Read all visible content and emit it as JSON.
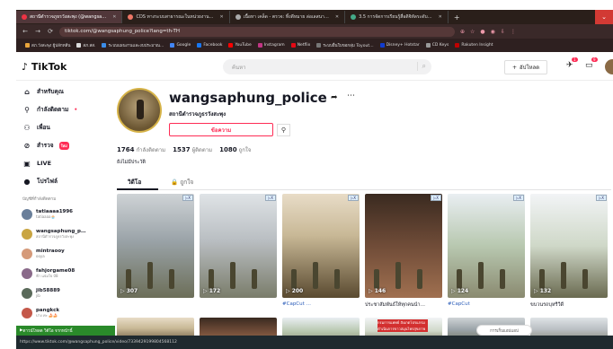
{
  "browser": {
    "tabs": [
      {
        "label": "สถานีตำรวจภูธรวังสะพุง (@wangsa…",
        "active": true
      },
      {
        "label": "CDS ทางระบบสาธารณะในหน่วยงาน…",
        "active": false
      },
      {
        "label": "เนื้อหา เคล็ด - ตรวจ: ทิ้งดีหมาย ล่อเลสนา…",
        "active": false
      },
      {
        "label": "3.5 การจัดการเรียนรู้สื่อดิจิทัลระดับ…",
        "active": false
      }
    ],
    "new_tab": "+",
    "url": "tiktok.com/@wangsaphung_police?lang=th-TH",
    "bookmarks": [
      {
        "label": "สภ.วังสะพุง ผู้ปลักทลีน",
        "color": "#e9a53b"
      },
      {
        "label": "สภ.สส.",
        "color": "#ddd"
      },
      {
        "label": "ระบบแผนงานและงบประมาณ…",
        "color": "#3b8de9"
      },
      {
        "label": "Google",
        "color": "#4285f4"
      },
      {
        "label": "Facebook",
        "color": "#1877f2"
      },
      {
        "label": "YouTube",
        "color": "#ff0000"
      },
      {
        "label": "Instagram",
        "color": "#c13584"
      },
      {
        "label": "Netflix",
        "color": "#e50914"
      },
      {
        "label": "ระบบยื่นใบขอกลุ่ม Toyout…",
        "color": "#777"
      },
      {
        "label": "Disney+ Hotstar",
        "color": "#113ccf"
      },
      {
        "label": "CD Keys",
        "color": "#999"
      },
      {
        "label": "Rakuten Insight",
        "color": "#bf0000"
      }
    ],
    "status_url": "https://www.tiktok.com/@wangsaphung_police/video/7339429199804568112",
    "download_label": "ดาวน์โหลด วิดีโอ จากหน้านี้"
  },
  "header": {
    "logo": "TikTok",
    "search_placeholder": "ค้นหา",
    "upload_label": "อัปโหลด",
    "inbox_badge": "1",
    "messages_badge": "9"
  },
  "sidebar": {
    "nav": [
      {
        "label": "สำหรับคุณ",
        "icon": "home-icon"
      },
      {
        "label": "กำลังติดตาม",
        "icon": "following-icon"
      },
      {
        "label": "เพื่อน",
        "icon": "friends-icon"
      },
      {
        "label": "สำรวจ",
        "icon": "explore-icon",
        "badge": "ใหม่"
      },
      {
        "label": "LIVE",
        "icon": "live-icon"
      },
      {
        "label": "โปรไฟล์",
        "icon": "profile-icon"
      }
    ],
    "following_title": "บัญชีที่กำลังติดตาม",
    "accounts": [
      {
        "name": "tatiaaaa1996",
        "sub": "tatiaaaa🧁"
      },
      {
        "name": "wangsaphung_p…",
        "sub": "สถานีตำรวจภูธรวังสะพุง"
      },
      {
        "name": "mintraooy",
        "sub": "ooya"
      },
      {
        "name": "fahjorgame08",
        "sub": "ฟ้า แจ่มใจ 08"
      },
      {
        "name": "jib58889",
        "sub": "jib"
      },
      {
        "name": "pangkck",
        "sub": "ปาง ค่ะ 🍰🍰"
      }
    ]
  },
  "profile": {
    "username": "wangsaphung_police",
    "display_name": "สถานีตำรวจภูธรวังสะพุง",
    "message_button": "ข้อความ",
    "stats": [
      {
        "value": "1764",
        "label": "กำลังติดตาม"
      },
      {
        "value": "1537",
        "label": "ผู้ติดตาม"
      },
      {
        "value": "1080",
        "label": "ถูกใจ"
      }
    ],
    "bio": "ยังไม่มีประวัติ",
    "tabs": {
      "videos": "วิดีโอ",
      "liked": "ถูกใจ"
    }
  },
  "videos": [
    {
      "views": "307",
      "caption": "",
      "tag": false
    },
    {
      "views": "172",
      "caption": "",
      "tag": false
    },
    {
      "views": "200",
      "caption": "#CapCut …",
      "tag": true
    },
    {
      "views": "146",
      "caption": "ประชาสัมพันธ์ให้ทุกคนนำ…",
      "tag": false
    },
    {
      "views": "124",
      "caption": "#CapCut",
      "tag": true
    },
    {
      "views": "132",
      "caption": "ขบวนรถบุหรีวีดี",
      "tag": false
    }
  ],
  "ad_tag": "▷X",
  "row2_red_text": "กรมการแพทย์ สังเกตโปรแกรม ดำเนินการขาวสมุนไพรสุขภาพ",
  "get_app": "การเก็บแอปแอป",
  "colors": {
    "accent": "#fe2c55",
    "link": "#2b5db9"
  }
}
